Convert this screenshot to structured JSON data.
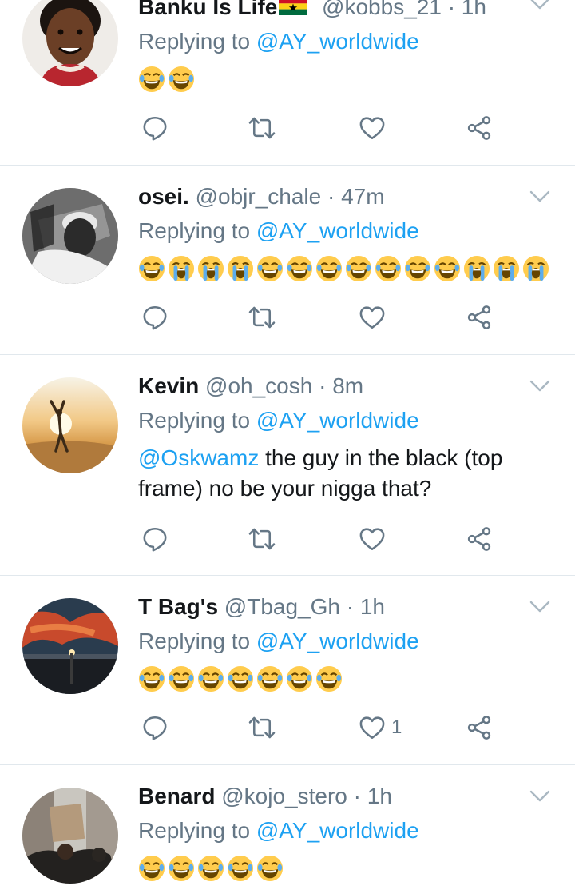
{
  "colors": {
    "link": "#1da1f2",
    "secondary": "#657786",
    "divider": "#e1e8ed",
    "text": "#14171a"
  },
  "reply_prefix": "Replying to",
  "replying_to": "@AY_worldwide",
  "icons": {
    "reply": "reply-icon",
    "retweet": "retweet-icon",
    "like": "heart-icon",
    "share": "share-icon",
    "menu": "chevron-down-icon"
  },
  "tweets": [
    {
      "name": "Banku Is Life",
      "flag": "ghana-flag",
      "handle": "@kobbs_21",
      "dot": "·",
      "time": "1h",
      "emojis": [
        "joy",
        "joy"
      ],
      "likes": ""
    },
    {
      "name": "osei.",
      "handle": "@objr_chale",
      "dot": "·",
      "time": "47m",
      "emojis": [
        "joy",
        "sob",
        "sob",
        "sob",
        "joy",
        "joy",
        "joy",
        "joy",
        "joy",
        "joy",
        "joy",
        "sob",
        "sob",
        "sob"
      ],
      "likes": ""
    },
    {
      "name": "Kevin",
      "handle": "@oh_cosh",
      "dot": "·",
      "time": "8m",
      "mention": "@Oskwamz",
      "text_line1": " the guy in the black (top",
      "text_line2": "frame) no be your nigga that?",
      "likes": ""
    },
    {
      "name": "T Bag's",
      "handle": "@Tbag_Gh",
      "dot": "·",
      "time": "1h",
      "emojis": [
        "joy",
        "joy",
        "joy",
        "joy",
        "joy",
        "joy",
        "joy"
      ],
      "likes": "1"
    },
    {
      "name": "Benard",
      "handle": "@kojo_stero",
      "dot": "·",
      "time": "1h",
      "emojis": [
        "joy",
        "joy",
        "joy",
        "joy",
        "joy"
      ],
      "likes": ""
    }
  ]
}
